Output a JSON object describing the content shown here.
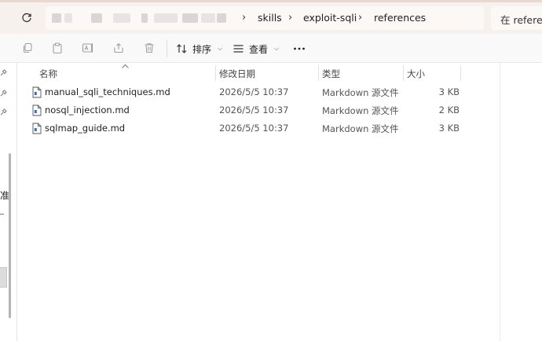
{
  "address_bar": {
    "breadcrumbs": [
      "skills",
      "exploit-sqli",
      "references"
    ],
    "search_placeholder": "在 references 中搜索"
  },
  "toolbar": {
    "sort_label": "排序",
    "view_label": "查看",
    "icons": [
      "copy-icon",
      "paste-icon",
      "rename-icon",
      "share-icon",
      "delete-icon",
      "sort-icon",
      "view-icon",
      "more-icon"
    ]
  },
  "nav": {
    "partial_text": "准"
  },
  "columns": {
    "name": "名称",
    "date": "修改日期",
    "type": "类型",
    "size": "大小"
  },
  "files": [
    {
      "name": "manual_sqli_techniques.md",
      "date": "2026/5/5 10:37",
      "type": "Markdown 源文件",
      "size": "3 KB"
    },
    {
      "name": "nosql_injection.md",
      "date": "2026/5/5 10:37",
      "type": "Markdown 源文件",
      "size": "2 KB"
    },
    {
      "name": "sqlmap_guide.md",
      "date": "2026/5/5 10:37",
      "type": "Markdown 源文件",
      "size": "3 KB"
    }
  ]
}
